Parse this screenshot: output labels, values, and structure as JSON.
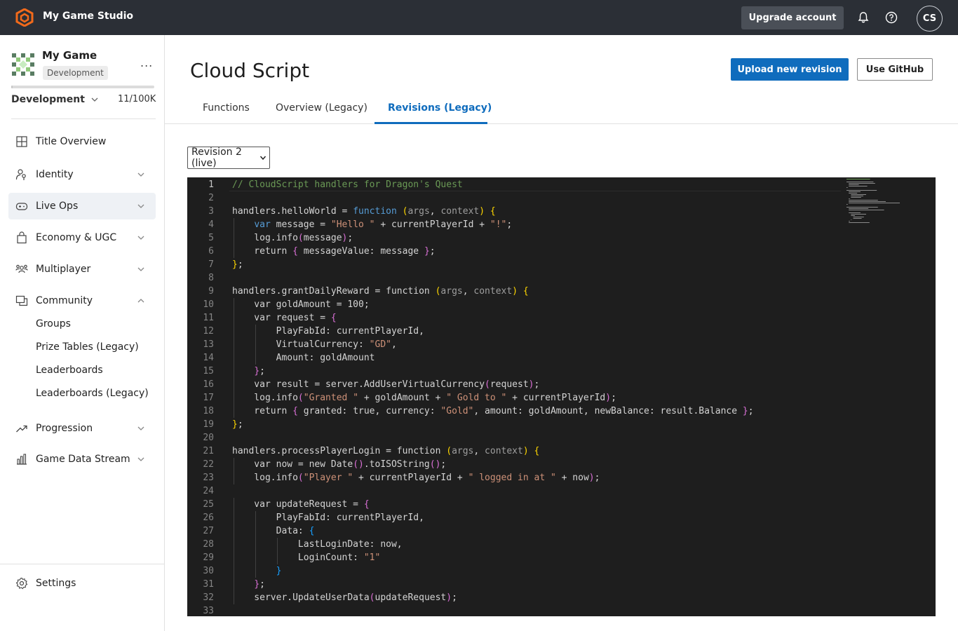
{
  "header": {
    "studio_name": "My Game Studio",
    "upgrade_label": "Upgrade account",
    "avatar_initials": "CS",
    "brand_color": "#f26a1b"
  },
  "sidebar": {
    "game_name": "My Game",
    "env_badge": "Development",
    "more_label": "...",
    "env_select": "Development",
    "usage_count": "11/100K",
    "usage_fraction": 0.0001,
    "items": [
      {
        "label": "Title Overview",
        "icon": "grid-icon",
        "chevron": false
      },
      {
        "label": "Identity",
        "icon": "person-key-icon",
        "chevron": "down"
      },
      {
        "label": "Live Ops",
        "icon": "gamepad-icon",
        "chevron": "down",
        "active": true
      },
      {
        "label": "Economy & UGC",
        "icon": "shopping-bag-icon",
        "chevron": "down"
      },
      {
        "label": "Multiplayer",
        "icon": "people-icon",
        "chevron": "down"
      },
      {
        "label": "Community",
        "icon": "chat-window-icon",
        "chevron": "up"
      },
      {
        "label": "Progression",
        "icon": "trending-up-icon",
        "chevron": "down"
      },
      {
        "label": "Game Data Stream",
        "icon": "bar-chart-icon",
        "chevron": "down"
      }
    ],
    "community_subitems": [
      "Groups",
      "Prize Tables (Legacy)",
      "Leaderboards",
      "Leaderboards (Legacy)"
    ],
    "settings_label": "Settings"
  },
  "main": {
    "title": "Cloud Script",
    "upload_label": "Upload new revision",
    "github_label": "Use GitHub",
    "tabs": [
      "Functions",
      "Overview (Legacy)",
      "Revisions (Legacy)"
    ],
    "active_tab": "Revisions (Legacy)",
    "revision_select": "Revision 2 (live)"
  },
  "editor": {
    "current_line": 1,
    "lines": [
      "// CloudScript handlers for Dragon's Quest",
      "",
      "handlers.helloWorld = function (args, context) {",
      "    var message = \"Hello \" + currentPlayerId + \"!\";",
      "    log.info(message);",
      "    return { messageValue: message };",
      "};",
      "",
      "handlers.grantDailyReward = function (args, context) {",
      "    var goldAmount = 100;",
      "    var request = {",
      "        PlayFabId: currentPlayerId,",
      "        VirtualCurrency: \"GD\",",
      "        Amount: goldAmount",
      "    };",
      "    var result = server.AddUserVirtualCurrency(request);",
      "    log.info(\"Granted \" + goldAmount + \" Gold to \" + currentPlayerId);",
      "    return { granted: true, currency: \"Gold\", amount: goldAmount, newBalance: result.Balance };",
      "};",
      "",
      "handlers.processPlayerLogin = function (args, context) {",
      "    var now = new Date().toISOString();",
      "    log.info(\"Player \" + currentPlayerId + \" logged in at \" + now);",
      "",
      "    var updateRequest = {",
      "        PlayFabId: currentPlayerId,",
      "        Data: {",
      "            LastLoginDate: now,",
      "            LoginCount: \"1\"",
      "        }",
      "    };",
      "    server.UpdateUserData(updateRequest);",
      ""
    ]
  }
}
